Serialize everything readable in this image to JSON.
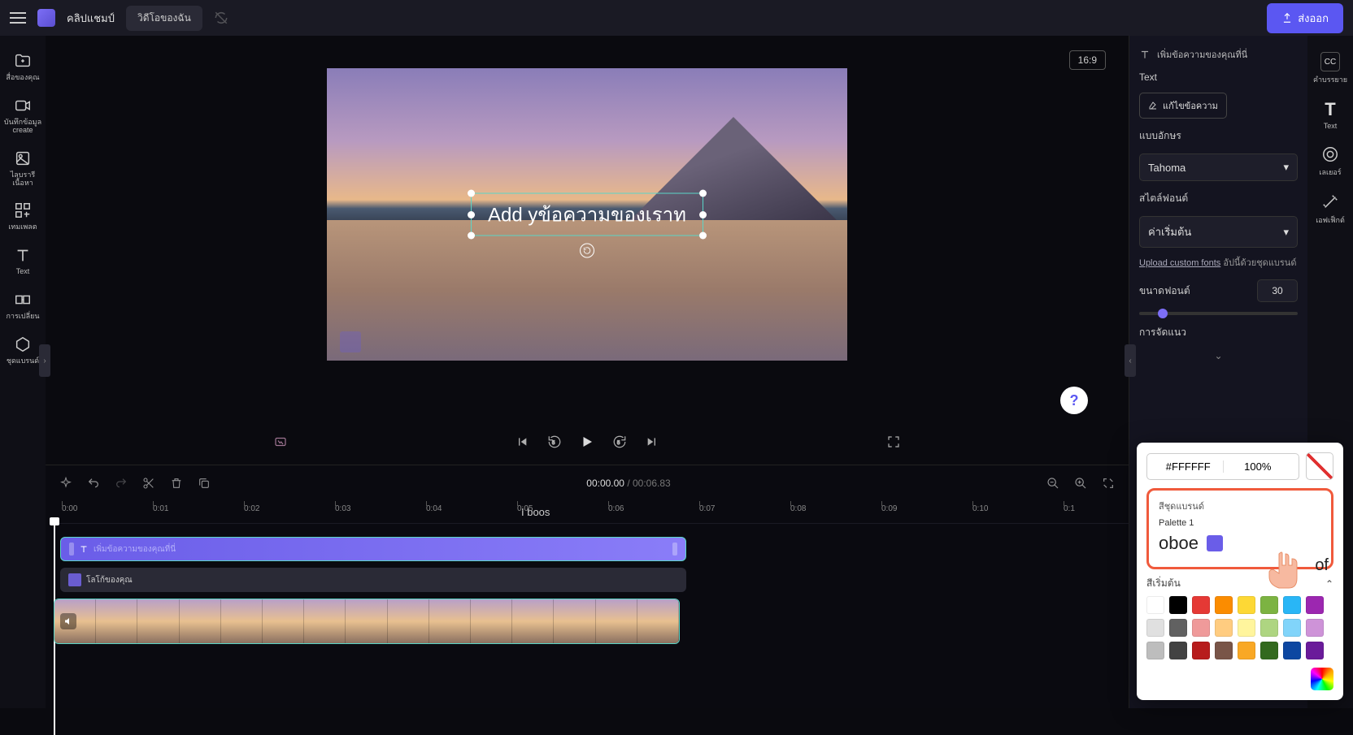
{
  "app": {
    "name": "คลิปแชมป์",
    "tab": "วิดีโอของฉัน"
  },
  "export": {
    "label": "ส่งออก"
  },
  "leftbar": [
    {
      "label": "สื่อของคุณ"
    },
    {
      "label": "บันทึกข้อมูล",
      "sublabel": "create"
    },
    {
      "label": "ไลบรารีเนื้อหา"
    },
    {
      "label": "เทมเพลต"
    },
    {
      "label": "Text"
    },
    {
      "label": "การเปลี่ยน"
    },
    {
      "label": "ชุดแบรนด์"
    }
  ],
  "canvas": {
    "aspect": "16:9",
    "text_overlay": "Add yข้อความของเราท"
  },
  "playback": {
    "current": "00:00.00",
    "duration": "00:06.83"
  },
  "ruler": {
    "ticks": [
      "0:00",
      "0:01",
      "0:02",
      "0:03",
      "0:04",
      "0:05",
      "0:06",
      "0:07",
      "0:08",
      "0:09",
      "0:10",
      "0:1"
    ],
    "floating_label": "I boos"
  },
  "tracks": {
    "text_clip": "เพิ่มข้อความของคุณที่นี่",
    "logo_clip": "โลโก้ของคุณ"
  },
  "rightpanel": {
    "header": "เพิ่มข้อความของคุณที่นี่",
    "section_text": "Text",
    "edit_text_btn": "แก้ไขข้อความ",
    "font_label": "แบบอักษร",
    "font_value": "Tahoma",
    "style_label": "สไตล์ฟอนต์",
    "style_value": "ค่าเริ่มต้น",
    "upload_fonts_link": "Upload custom fonts",
    "upload_fonts_suffix": " อัปนี้ด้วยชุดแบรนด์",
    "size_label": "ขนาดฟอนต์",
    "size_value": "30",
    "align_label": "การจัดแนว"
  },
  "farright": [
    {
      "label": "คำบรรยาย",
      "badge": "CC"
    },
    {
      "label": "Text",
      "badge": "T"
    },
    {
      "label": "เลเยอร์"
    },
    {
      "label": "เอฟเฟ็กต์"
    }
  ],
  "colorpicker": {
    "hex": "#FFFFFF",
    "opacity": "100%",
    "brand_label": "สีชุดแบรนด์",
    "palette_name": "Palette 1",
    "inline_word": "oboe",
    "brand_swatch": "#6a5de8",
    "default_label": "สีเริ่มต้น",
    "extra_word": "of",
    "grid": [
      "#ffffff",
      "#000000",
      "#e53935",
      "#fb8c00",
      "#fdd835",
      "#7cb342",
      "#29b6f6",
      "#9c27b0",
      "#e0e0e0",
      "#616161",
      "#ef9a9a",
      "#ffcc80",
      "#fff59d",
      "#aed581",
      "#81d4fa",
      "#ce93d8",
      "#bdbdbd",
      "#424242",
      "#b71c1c",
      "#795548",
      "#f9a825",
      "#33691e",
      "#0d47a1",
      "#6a1b9a"
    ]
  }
}
